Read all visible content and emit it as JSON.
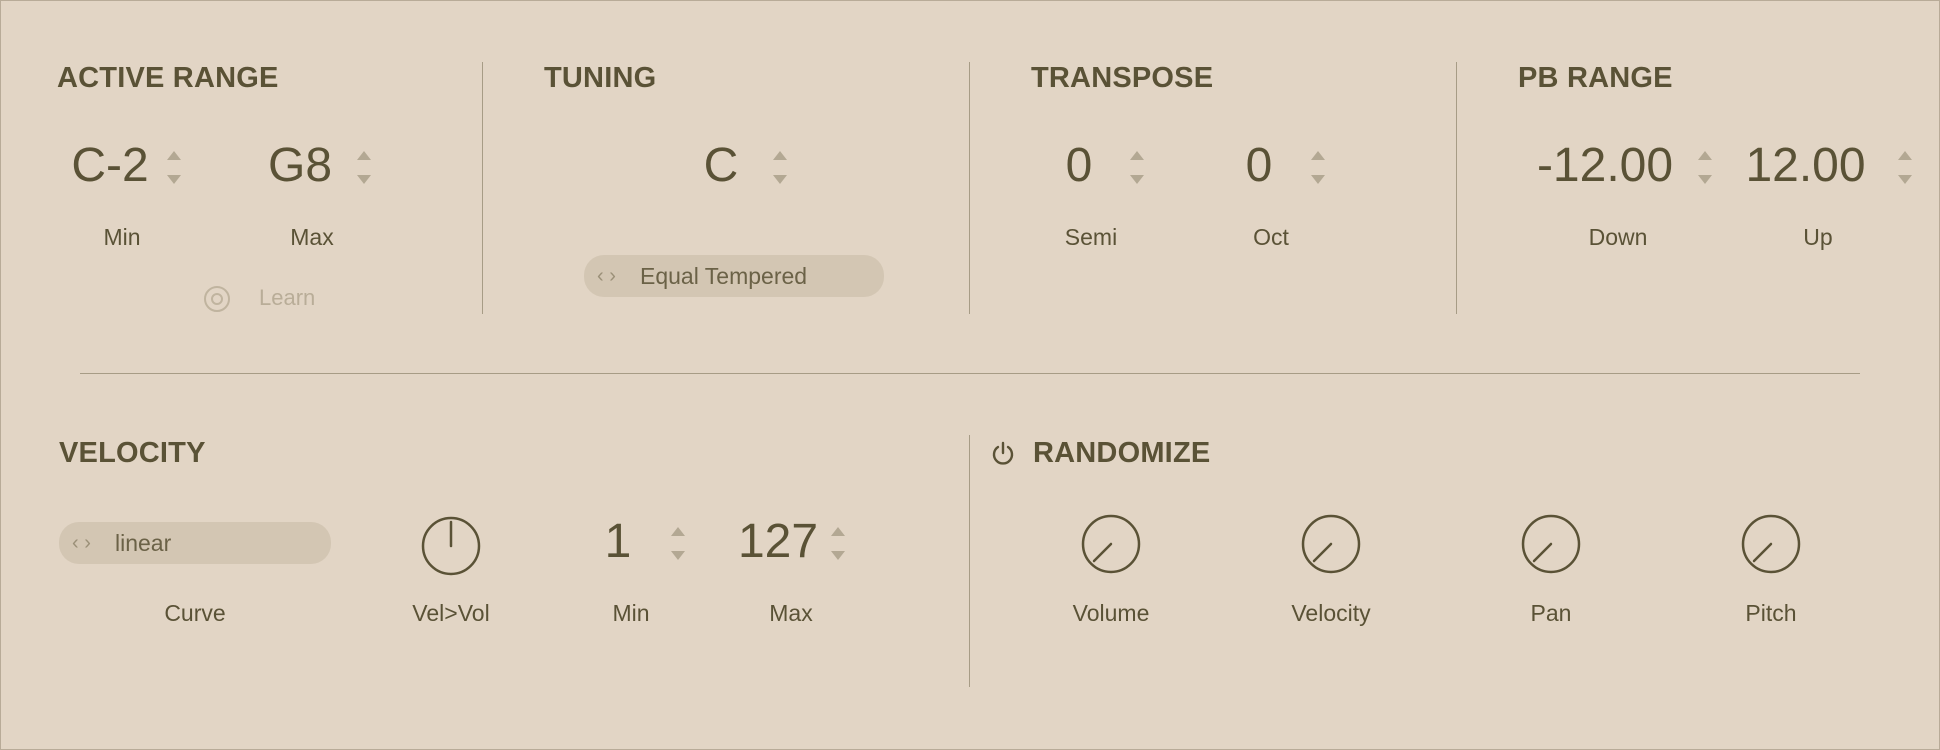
{
  "active_range": {
    "title": "ACTIVE RANGE",
    "min_value": "C-2",
    "max_value": "G8",
    "min_label": "Min",
    "max_label": "Max",
    "learn_label": "Learn"
  },
  "tuning": {
    "title": "TUNING",
    "key_value": "C",
    "temperament": "Equal Tempered"
  },
  "transpose": {
    "title": "TRANSPOSE",
    "semi_value": "0",
    "oct_value": "0",
    "semi_label": "Semi",
    "oct_label": "Oct"
  },
  "pb_range": {
    "title": "PB RANGE",
    "down_value": "-12.00",
    "up_value": "12.00",
    "down_label": "Down",
    "up_label": "Up"
  },
  "velocity": {
    "title": "VELOCITY",
    "curve_value": "linear",
    "curve_label": "Curve",
    "velvol_label": "Vel>Vol",
    "min_value": "1",
    "max_value": "127",
    "min_label": "Min",
    "max_label": "Max"
  },
  "randomize": {
    "title": "RANDOMIZE",
    "knobs": [
      {
        "label": "Volume"
      },
      {
        "label": "Velocity"
      },
      {
        "label": "Pan"
      },
      {
        "label": "Pitch"
      }
    ]
  },
  "colors": {
    "background": "#e2d5c5",
    "text": "#5a5236",
    "divider": "#a79c86",
    "pill": "#d3c6b3"
  }
}
